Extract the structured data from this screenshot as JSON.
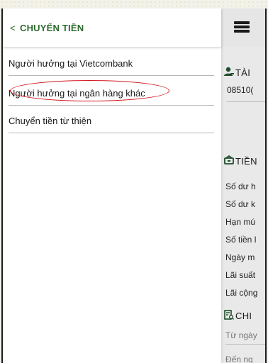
{
  "drawer": {
    "back_icon": "chevron-left-icon",
    "title": "CHUYỂN TIỀN",
    "items": [
      {
        "label": "Người hưởng tại Vietcombank"
      },
      {
        "label": "Người hưởng tại ngân hàng khác"
      },
      {
        "label": "Chuyển tiền từ thiện"
      }
    ]
  },
  "background_app": {
    "menu_icon": "hamburger-icon",
    "account_section": {
      "icon": "user-icon",
      "title": "TÀI",
      "account_number": "08510("
    },
    "savings_section": {
      "icon": "piggy-bank-icon",
      "title": "TIỀN",
      "rows": [
        "Số dư h",
        "Số dư k",
        "Hạn mú",
        "Số tiền l",
        "Ngày m",
        "Lãi suất",
        "Lãi cộng"
      ]
    },
    "detail_section": {
      "icon": "document-search-icon",
      "title": "CHI",
      "from_placeholder": "Từ ngày",
      "to_placeholder": "Đến ng"
    }
  },
  "colors": {
    "title_green": "#2e6b2e",
    "highlight_red": "#d0151b",
    "panel_gray": "#e9e9e9"
  }
}
